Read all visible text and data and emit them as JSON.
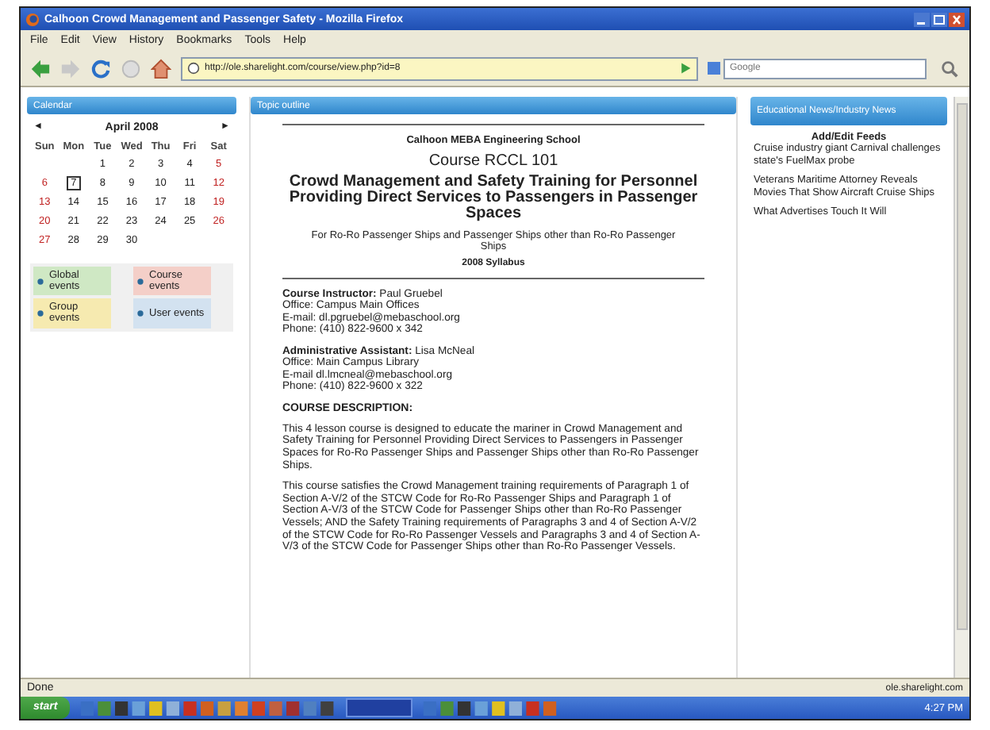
{
  "window": {
    "title": "Calhoon Crowd Management and Passenger Safety - Mozilla Firefox"
  },
  "menu": [
    "File",
    "Edit",
    "View",
    "History",
    "Bookmarks",
    "Tools",
    "Help"
  ],
  "address_bar": {
    "value": "http://ole.sharelight.com/course/view.php?id=8"
  },
  "search": {
    "placeholder": "Google"
  },
  "calendar": {
    "title": "Calendar",
    "month": "April 2008",
    "prev": "◄",
    "next": "►",
    "weekdays": [
      "Sun",
      "Mon",
      "Tue",
      "Wed",
      "Thu",
      "Fri",
      "Sat"
    ],
    "weeks": [
      {
        "kind": "leading",
        "days": [
          {
            "d": "1",
            "weekend": false,
            "today": false
          },
          {
            "d": "2",
            "weekend": false,
            "today": false
          },
          {
            "d": "3",
            "weekend": false,
            "today": false
          },
          {
            "d": "4",
            "weekend": false,
            "today": false
          },
          {
            "d": "5",
            "weekend": true,
            "today": false
          }
        ]
      },
      {
        "kind": "week",
        "days": [
          {
            "d": "6",
            "weekend": true,
            "today": false
          },
          {
            "d": "7",
            "weekend": false,
            "today": true
          },
          {
            "d": "8",
            "weekend": false,
            "today": false
          },
          {
            "d": "9",
            "weekend": false,
            "today": false
          },
          {
            "d": "10",
            "weekend": false,
            "today": false
          },
          {
            "d": "11",
            "weekend": false,
            "today": false
          },
          {
            "d": "12",
            "weekend": true,
            "today": false
          }
        ]
      },
      {
        "kind": "week",
        "days": [
          {
            "d": "13",
            "weekend": true,
            "today": false
          },
          {
            "d": "14",
            "weekend": false,
            "today": false
          },
          {
            "d": "15",
            "weekend": false,
            "today": false
          },
          {
            "d": "16",
            "weekend": false,
            "today": false
          },
          {
            "d": "17",
            "weekend": false,
            "today": false
          },
          {
            "d": "18",
            "weekend": false,
            "today": false
          },
          {
            "d": "19",
            "weekend": true,
            "today": false
          }
        ]
      },
      {
        "kind": "week",
        "days": [
          {
            "d": "20",
            "weekend": true,
            "today": false
          },
          {
            "d": "21",
            "weekend": false,
            "today": false
          },
          {
            "d": "22",
            "weekend": false,
            "today": false
          },
          {
            "d": "23",
            "weekend": false,
            "today": false
          },
          {
            "d": "24",
            "weekend": false,
            "today": false
          },
          {
            "d": "25",
            "weekend": false,
            "today": false
          },
          {
            "d": "26",
            "weekend": true,
            "today": false
          }
        ]
      },
      {
        "kind": "week",
        "days": [
          {
            "d": "27",
            "weekend": true,
            "today": false
          },
          {
            "d": "28",
            "weekend": false,
            "today": false
          },
          {
            "d": "29",
            "weekend": false,
            "today": false
          },
          {
            "d": "30",
            "weekend": false,
            "today": false
          }
        ]
      }
    ],
    "legend": [
      {
        "label": "Global events",
        "color": "#cfe8c4"
      },
      {
        "label": "Course events",
        "color": "#f4cfc8"
      },
      {
        "label": "Group events",
        "color": "#f6eab0"
      },
      {
        "label": "User events",
        "color": "#d3e2f0"
      }
    ]
  },
  "topic": {
    "title": "Topic outline",
    "school": "Calhoon MEBA Engineering School",
    "course": "Course RCCL 101",
    "heading": "Crowd Management and Safety Training for Personnel Providing Direct Services to Passengers in Passenger Spaces",
    "subtitle": "For Ro-Ro Passenger Ships and Passenger Ships other than Ro-Ro Passenger Ships",
    "syllabus": "2008 Syllabus",
    "contacts": [
      [
        "**Course Instructor:** Paul Gruebel",
        "Office: Campus Main Offices",
        "E-mail: dl.pgruebel@mebaschool.org",
        "Phone: (410) 822-9600 x 342"
      ],
      [
        "**Administrative Assistant:** Lisa McNeal",
        "Office: Main Campus Library",
        "E-mail dl.lmcneal@mebaschool.org",
        "Phone: (410) 822-9600 x 322"
      ]
    ],
    "section": "COURSE DESCRIPTION:",
    "paragraphs": [
      "This 4 lesson course is designed to educate the mariner in Crowd Management and Safety Training for Personnel Providing Direct Services to Passengers in Passenger Spaces for Ro-Ro Passenger Ships and Passenger Ships other than Ro-Ro Passenger Ships.",
      "This course satisfies the Crowd Management training requirements of Paragraph 1 of Section A-V/2 of the STCW Code for Ro-Ro Passenger Ships and Paragraph 1 of Section A-V/3 of the STCW Code for Passenger Ships other than Ro-Ro Passenger Vessels; AND the Safety Training requirements of Paragraphs 3 and 4 of Section A-V/2 of the STCW Code for Ro-Ro Passenger Vessels and Paragraphs 3 and 4 of Section A-V/3 of the STCW Code for Passenger Ships other than Ro-Ro Passenger Vessels."
    ]
  },
  "news": {
    "title": "Educational News/Industry News",
    "edit_link": "Add/Edit Feeds",
    "items": [
      "Cruise industry giant Carnival challenges state's FuelMax probe",
      "Veterans Maritime Attorney Reveals Movies That Show Aircraft Cruise Ships",
      "What Advertises Touch It Will"
    ]
  },
  "status_bar": {
    "text": "Done",
    "host": "ole.sharelight.com"
  },
  "taskbar": {
    "start": "start",
    "clock": "4:27 PM"
  }
}
